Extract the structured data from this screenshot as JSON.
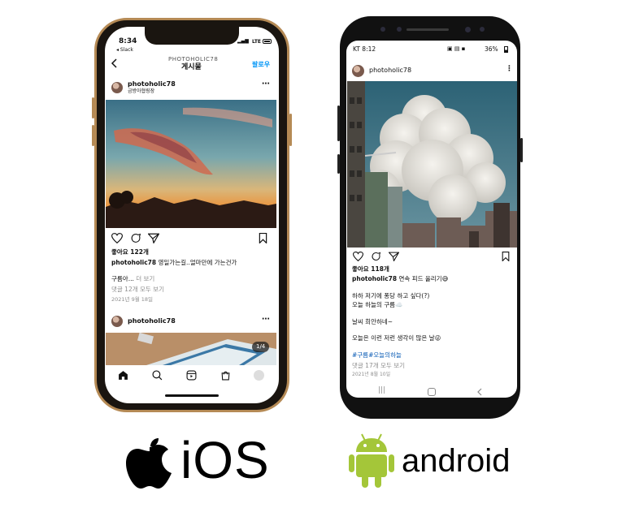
{
  "ios": {
    "status_time": "8:34",
    "status_back_app": "◂ Slack",
    "status_network": "LTE",
    "header_subtitle": "PHOTOHOLIC78",
    "header_title": "게시물",
    "follow_label": "팔로우",
    "username": "photoholic78",
    "location": "금방아협링장",
    "likes": "좋아요 122개",
    "caption_user": "photoholic78",
    "caption_text": "영일가는길..얼마만에 가는건가",
    "hashtag_line": "구름아...",
    "more_label": "더 보기",
    "comments": "댓글 12개 모두 보기",
    "date": "2021년 9월 18일",
    "second_username": "photoholic78",
    "carousel_counter": "1/4",
    "logo_label": "iOS"
  },
  "android": {
    "status_carrier": "KT 8:12",
    "status_battery": "36%",
    "username": "photoholic78",
    "likes": "좋아요 118개",
    "caption_user": "photoholic78",
    "caption_text": "연속 피드 올리기😅",
    "line1": "하하 저기에 퐁당 하고 싶다(?)",
    "line2": "오늘 하늘의 구름☁️",
    "line3": "날씨 희안하네~",
    "line4": "오늘은 이런 저런 생각이 많은 날😜",
    "hashtags": "#구름#오늘의하늘",
    "comments": "댓글 17개 모두 보기",
    "date": "2021년 8월 10일",
    "logo_label": "android"
  },
  "colors": {
    "ios_frame": "#b58a55",
    "android_frame": "#111111",
    "android_green": "#a4c639",
    "link_blue": "#0095f6"
  },
  "icons": [
    "apple-logo-icon",
    "android-robot-icon",
    "heart-icon",
    "comment-icon",
    "share-icon",
    "bookmark-icon",
    "more-icon",
    "back-icon",
    "home-icon",
    "search-icon",
    "reels-icon",
    "shop-icon",
    "profile-icon"
  ]
}
